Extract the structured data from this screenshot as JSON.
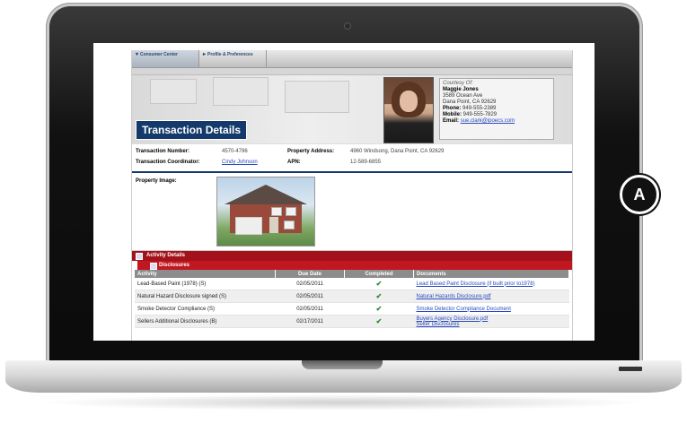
{
  "callout": "A",
  "tabs": [
    {
      "label": "Consumer Center"
    },
    {
      "label": "Profile & Preferences"
    }
  ],
  "header": {
    "title": "Transaction Details"
  },
  "courtesy": {
    "heading": "Courtesy Of:",
    "name": "Maggie Jones",
    "address1": "3589 Ocean Ave",
    "address2": "Dana Point, CA 92629",
    "phone_label": "Phone:",
    "phone": "949-555-2389",
    "mobile_label": "Mobile:",
    "mobile": "949-555-7829",
    "email_label": "Email:",
    "email": "sue.clark@ipoecs.com"
  },
  "transaction": {
    "number_label": "Transaction Number:",
    "number": "4570-4796",
    "coordinator_label": "Transaction Coordinator:",
    "coordinator": "Cindy Johnson",
    "address_label": "Property Address:",
    "address": "4960 Windsong, Dana Point, CA 92629",
    "apn_label": "APN:",
    "apn": "12-589-6855"
  },
  "property": {
    "label": "Property Image:"
  },
  "activity": {
    "header": "Activity Details",
    "section": "Disclosures",
    "columns": [
      "Activity",
      "Due Date",
      "Completed",
      "Documents"
    ],
    "rows": [
      {
        "activity": "Lead-Based Paint (1978) (S)",
        "due": "02/05/2011",
        "completed": "✔",
        "doc1": "Lead Based Paint Disclosure (if built prior to1978)",
        "doc2": ""
      },
      {
        "activity": "Natural Hazard Disclosure signed (S)",
        "due": "02/05/2011",
        "completed": "✔",
        "doc1": "Natural Hazards Disclosure.pdf",
        "doc2": ""
      },
      {
        "activity": "Smoke Detector Compliance (S)",
        "due": "02/05/2011",
        "completed": "✔",
        "doc1": "Smoke Detector Compliance Document",
        "doc2": ""
      },
      {
        "activity": "Sellers Additional Disclosures (B)",
        "due": "02/17/2011",
        "completed": "✔",
        "doc1": "Buyers Agency Disclosure.pdf",
        "doc2": "Seller Disclosures"
      }
    ]
  }
}
